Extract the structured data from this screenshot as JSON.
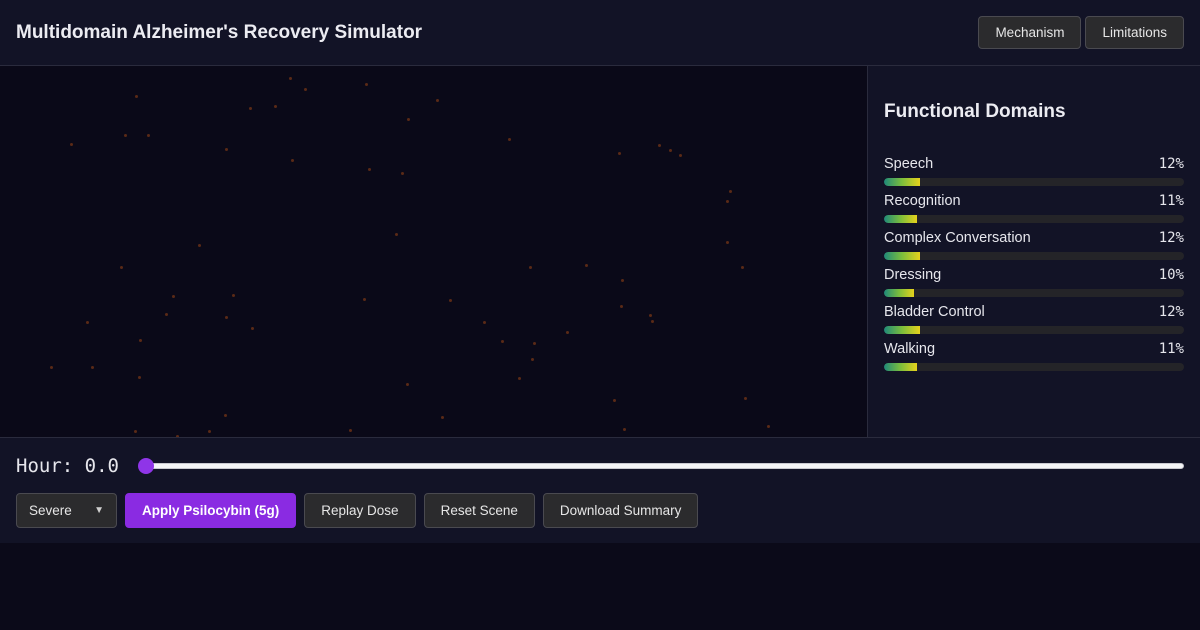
{
  "header": {
    "title": "Multidomain Alzheimer's Recovery Simulator",
    "buttons": {
      "mechanism": "Mechanism",
      "limitations": "Limitations"
    }
  },
  "panel": {
    "title": "Functional Domains",
    "domains": [
      {
        "name": "Speech",
        "value_label": "12%",
        "value": 12
      },
      {
        "name": "Recognition",
        "value_label": "11%",
        "value": 11
      },
      {
        "name": "Complex Conversation",
        "value_label": "12%",
        "value": 12
      },
      {
        "name": "Dressing",
        "value_label": "10%",
        "value": 10
      },
      {
        "name": "Bladder Control",
        "value_label": "12%",
        "value": 12
      },
      {
        "name": "Walking",
        "value_label": "11%",
        "value": 11
      }
    ]
  },
  "controls": {
    "hour_label": "Hour:",
    "hour_value": "0.0",
    "hour_slider_fraction": 0,
    "severity_selected": "Severe",
    "apply_label": "Apply Psilocybin (5g)",
    "replay_label": "Replay Dose",
    "reset_label": "Reset Scene",
    "download_label": "Download Summary"
  },
  "colors": {
    "accent": "#8a2be2",
    "bar_gradient_start": "#1f8a7a",
    "bar_gradient_end": "#e6d21c",
    "particle": "#5a2a16"
  }
}
